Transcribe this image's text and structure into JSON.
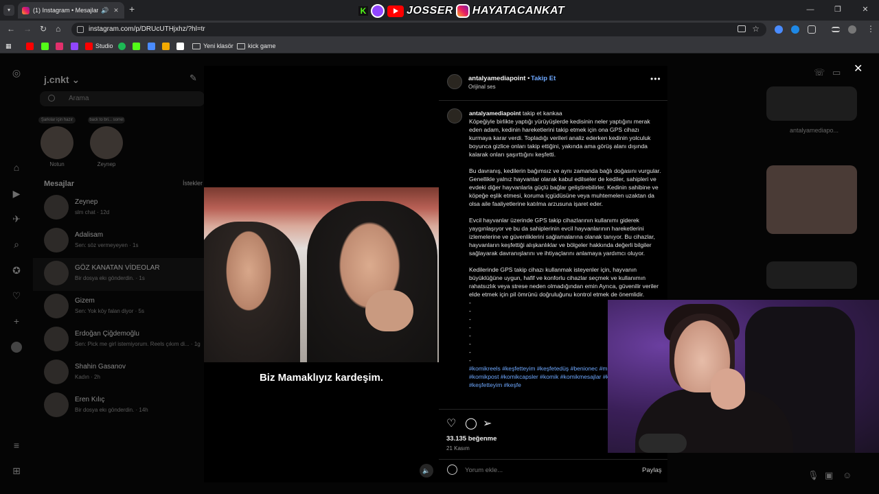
{
  "browser": {
    "tab_title": "(1) Instagram • Mesajlar",
    "new_tab_label": "+",
    "url": "instagram.com/p/DRUcUTHjxhz/?hl=tr",
    "bookmarks": [
      {
        "label": "",
        "color": "#ff0000"
      },
      {
        "label": "",
        "color": "#53fc18"
      },
      {
        "label": "",
        "color": "#e1306c"
      },
      {
        "label": "",
        "color": "#9146ff"
      },
      {
        "label": "Studio",
        "color": "#ff0000"
      },
      {
        "label": "",
        "color": "#1db954"
      },
      {
        "label": "",
        "color": "#53fc18"
      },
      {
        "label": "",
        "color": "#4a8cff"
      },
      {
        "label": "",
        "color": "#f2a900"
      },
      {
        "label": "",
        "color": "#ffffff"
      },
      {
        "label": "Yeni klasör",
        "color": ""
      },
      {
        "label": "kick game",
        "color": ""
      }
    ]
  },
  "overlay": {
    "brand1": "JOSSER",
    "brand2": "HAYATACANKAT"
  },
  "instagram": {
    "username": "j.cnkt",
    "search_placeholder": "Arama",
    "notes": [
      {
        "bubble": "Şarkılar için hazır",
        "name": "Notun"
      },
      {
        "bubble": "back to bri... sorrel",
        "name": "Zeynep"
      }
    ],
    "messages_title": "Mesajlar",
    "requests_label": "İstekler",
    "conversations": [
      {
        "name": "Zeynep",
        "preview": "slm chat · 12d"
      },
      {
        "name": "Adalisam",
        "preview": "Sen: söz vermeyeyen · 1s"
      },
      {
        "name": "GÖZ KANATAN VİDEOLAR",
        "preview": "Bir dosya ekı gönderdin. · 1s"
      },
      {
        "name": "Gizem",
        "preview": "Sen: Yok köy falan diyor · 5s"
      },
      {
        "name": "Erdoğan Çiğdemoğlu",
        "preview": "Sen: Pick me girl istemiyorum. Reels çıkım di... · 1g"
      },
      {
        "name": "Shahin Gasanov",
        "preview": "Kadın · 2h"
      },
      {
        "name": "Eren Kılıç",
        "preview": "Bir dosya ekı gönderdin. · 14h"
      }
    ],
    "chat_name": "antalyamediapo...",
    "close_symbol": "✕"
  },
  "post": {
    "author": "antalyamediapoint",
    "follow_label": "Takip Et",
    "audio": "Orijinal ses",
    "subtitle": "Biz Mamaklıyız kardeşim.",
    "caption_lead": "takip et kankaa",
    "paragraphs": [
      "Köpeğiyle birlikte yaptığı yürüyüşlerde kedisinin neler yaptığını merak eden adam, kedinin hareketlerini takip etmek için ona GPS cihazı kurmaya karar verdi. Topladığı verileri analiz ederken kedinin yolculuk boyunca gizlice onları takip ettiğini, yakında ama görüş alanı dışında kalarak onları şaşırttığını keşfetti.",
      "Bu davranış, kedilerin bağımsız ve aynı zamanda bağlı doğasını vurgular. Genellikle yalnız hayvanlar olarak kabul edilseler de kediler, sahipleri ve evdeki diğer hayvanlarla güçlü bağlar geliştirebilirler. Kedinin sahibine ve köpeğe eşlik etmesi, koruma içgüdüsüne veya muhtemelen uzaktan da olsa aile faaliyetlerine katılma arzusuna işaret eder.",
      "Evcil hayvanlar üzerinde GPS takip cihazlarının kullanımı giderek yaygınlaşıyor ve bu da sahiplerinin evcil hayvanlarının hareketlerini izlemelerine ve güvenliklerini sağlamalarına olanak tanıyor. Bu cihazlar, hayvanların keşfettiği alışkanlıklar ve bölgeler hakkında değerli bilgiler sağlayarak davranışlarını ve ihtiyaçlarını anlamaya yardımcı oluyor.",
      "Kedilerinde GPS takip cihazı kullanmak isteyenler için, hayvanın büyüklüğüne uygun, hafif ve konforlu cihazlar seçmek ve kullanımın rahatsızlık veya strese neden olmadığından emin Ayrıca, güvenilir veriler elde etmek için pil ömrünü doğruluğunu kontrol etmek de önemlidir."
    ],
    "dashes": [
      "-",
      "-",
      "-",
      "-",
      "-",
      "-",
      "-",
      "-"
    ],
    "hashtags": "#komikreels #keşfetteyim #keşfetedüş #benionec #mizahtürkiye #komikpost #komikcapsler #komik #komikmesajlar #keşfetimiaç #keşfetteyim #keşfe",
    "likes": "33.135 beğenme",
    "date": "21 Kasım",
    "comment_placeholder": "Yorum ekle...",
    "share_label": "Paylaş"
  }
}
